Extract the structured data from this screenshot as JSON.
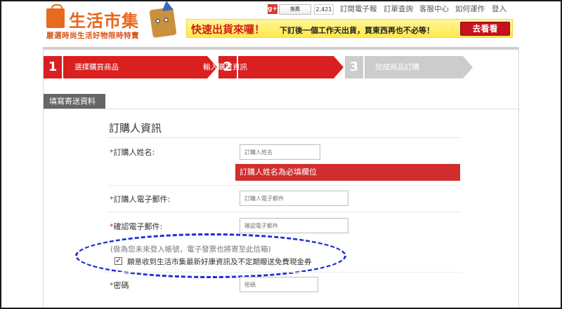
{
  "header": {
    "logo_title": "生活市集",
    "logo_slogan": "嚴選時尚生活好物限時特賣",
    "gplus_label": "g+",
    "recommend_label": "推薦",
    "recommend_count": "2,421",
    "top_links": [
      "訂閱電子報",
      "訂單查詢",
      "客服中心",
      "如何運作",
      "登入"
    ]
  },
  "banner": {
    "main": "快速出貨來囉！",
    "sub": "下訂後一個工作天出貨，買東西再也不必等！",
    "button": "去看看"
  },
  "steps": [
    {
      "num": "1",
      "label": "選擇購買商品",
      "state": "done"
    },
    {
      "num": "2",
      "label": "輸入購買資訊",
      "state": "active"
    },
    {
      "num": "3",
      "label": "完成商品訂購",
      "state": "todo"
    }
  ],
  "section": {
    "tab": "填寫寄送資料"
  },
  "form": {
    "title": "訂購人資訊",
    "required_mark": "*",
    "name": {
      "label": "訂購人姓名:",
      "placeholder": "訂購人姓名"
    },
    "name_error": "訂購人姓名為必填欄位",
    "email": {
      "label": "訂購人電子郵件:",
      "placeholder": "訂購人電子郵件"
    },
    "email_confirm": {
      "label": "確認電子郵件:",
      "placeholder": "確認電子郵件"
    },
    "note": "(做為您未來登入帳號，電子發票也將寄至此信箱)",
    "subscribe": {
      "label": "願意收到生活市集最新好康資訊及不定期贈送免費現金券",
      "checked": true
    },
    "password": {
      "label": "密碼",
      "placeholder": "密碼"
    }
  },
  "colors": {
    "brand": "#e8661a",
    "step_active": "#d91f1f",
    "step_todo": "#cccccc",
    "error": "#d22e2e",
    "annotation": "#1e2bd6"
  }
}
